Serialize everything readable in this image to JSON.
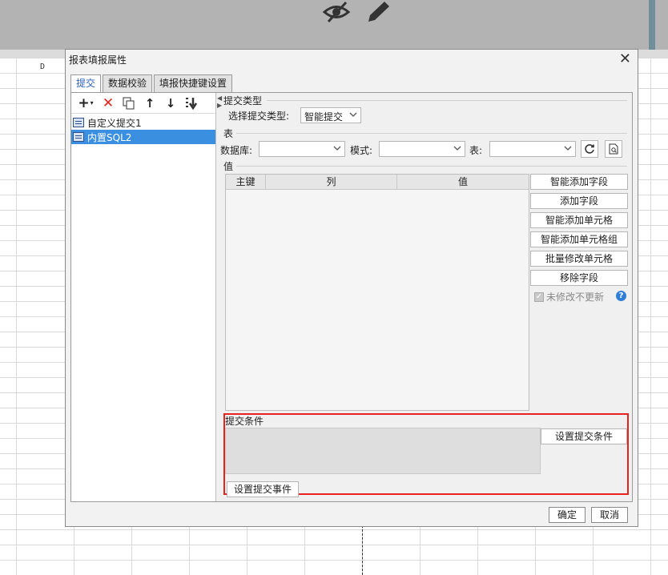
{
  "spreadsheet": {
    "cell_label": "D"
  },
  "dialog": {
    "title": "报表填报属性",
    "close_glyph": "✕",
    "tabs": [
      {
        "label": "提交"
      },
      {
        "label": "数据校验"
      },
      {
        "label": "填报快捷键设置"
      }
    ],
    "tree_items": [
      {
        "label": "自定义提交1"
      },
      {
        "label": "内置SQL2"
      }
    ],
    "submit_type": {
      "section": "提交类型",
      "label": "选择提交类型:",
      "value": "智能提交"
    },
    "table_section": {
      "section": "表",
      "db_label": "数据库:",
      "schema_label": "模式:",
      "table_label": "表:"
    },
    "value_section": {
      "section": "值",
      "columns": [
        "主键",
        "列",
        "值"
      ],
      "buttons": [
        "智能添加字段",
        "添加字段",
        "智能添加单元格",
        "智能添加单元格组",
        "批量修改单元格",
        "移除字段"
      ],
      "checkbox_label": "未修改不更新",
      "checkbox_checked": true
    },
    "condition": {
      "section": "提交条件",
      "set_condition": "设置提交条件",
      "set_event": "设置提交事件"
    },
    "footer": {
      "ok": "确定",
      "cancel": "取消"
    }
  },
  "colors": {
    "highlight": "#e8231f",
    "selection": "#3b8fe0",
    "active_tab_text": "#2c62b8"
  }
}
